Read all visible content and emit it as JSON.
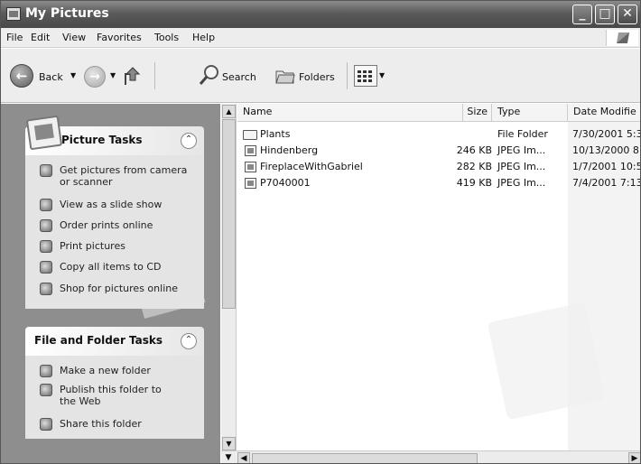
{
  "window": {
    "title": "My Pictures"
  },
  "menu": {
    "items": [
      "File",
      "Edit",
      "View",
      "Favorites",
      "Tools",
      "Help"
    ]
  },
  "toolbar": {
    "back_label": "Back",
    "search_label": "Search",
    "folders_label": "Folders"
  },
  "picture_tasks": {
    "title": "Picture Tasks",
    "items": [
      {
        "label": "Get pictures from camera or scanner",
        "icon": "camera-icon"
      },
      {
        "label": "View as a slide show",
        "icon": "slideshow-icon"
      },
      {
        "label": "Order prints online",
        "icon": "order-prints-icon"
      },
      {
        "label": "Print pictures",
        "icon": "printer-icon"
      },
      {
        "label": "Copy all items to CD",
        "icon": "cd-icon"
      },
      {
        "label": "Shop for pictures online",
        "icon": "shop-icon"
      }
    ]
  },
  "file_folder_tasks": {
    "title": "File and Folder Tasks",
    "items": [
      {
        "label": "Make a new folder",
        "icon": "new-folder-icon"
      },
      {
        "label": "Publish this folder to the Web",
        "icon": "globe-icon"
      },
      {
        "label": "Share this folder",
        "icon": "share-folder-icon"
      }
    ]
  },
  "list": {
    "columns": [
      "Name",
      "Size",
      "Type",
      "Date Modifie"
    ],
    "rows": [
      {
        "name": "Plants",
        "size": "",
        "type": "File Folder",
        "date": "7/30/2001 5:3",
        "kind": "folder"
      },
      {
        "name": "Hindenberg",
        "size": "246 KB",
        "type": "JPEG Im...",
        "date": "10/13/2000 8",
        "kind": "file"
      },
      {
        "name": "FireplaceWithGabriel",
        "size": "282 KB",
        "type": "JPEG Im...",
        "date": "1/7/2001 10:5",
        "kind": "file"
      },
      {
        "name": "P7040001",
        "size": "419 KB",
        "type": "JPEG Im...",
        "date": "7/4/2001 7:13",
        "kind": "file"
      }
    ]
  }
}
